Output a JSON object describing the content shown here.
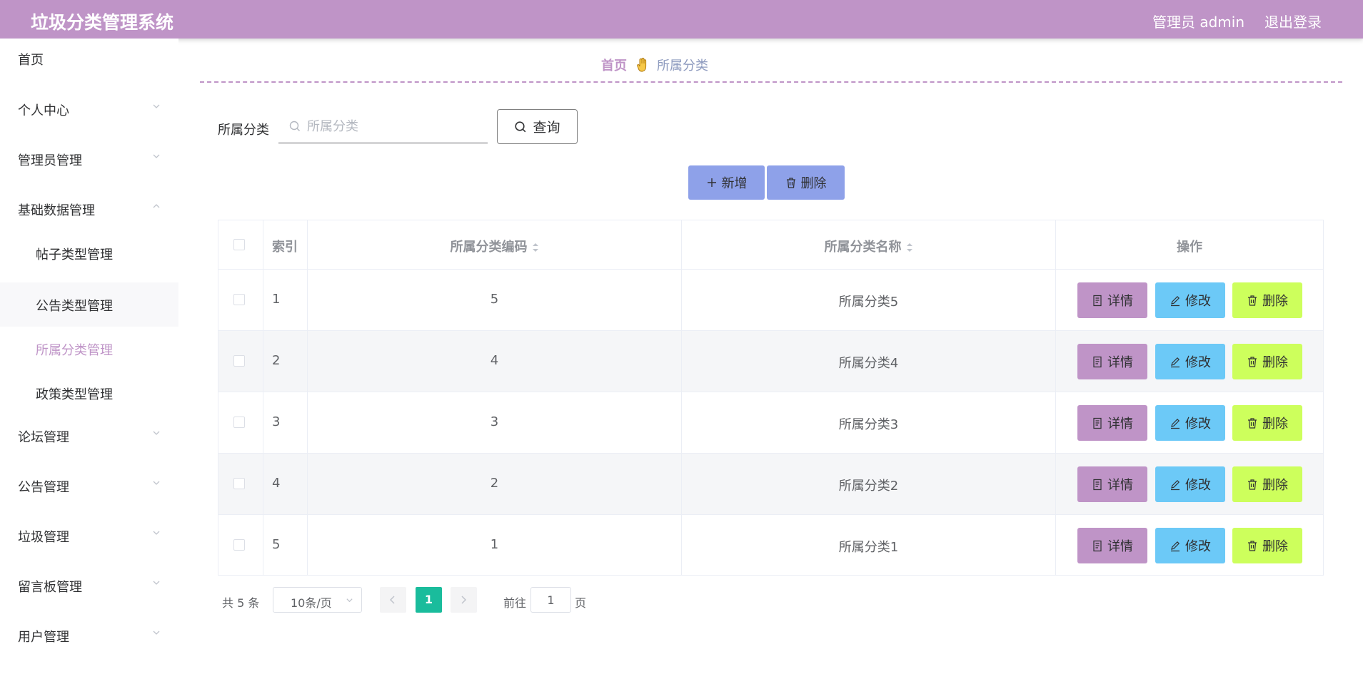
{
  "header": {
    "title": "垃圾分类管理系统",
    "user": "管理员 admin",
    "logout": "退出登录",
    "bg_color": "#bf94c7"
  },
  "sidebar": {
    "items": [
      {
        "label": "首页",
        "has_chevron": false
      },
      {
        "label": "个人中心",
        "has_chevron": true,
        "expanded": false
      },
      {
        "label": "管理员管理",
        "has_chevron": true,
        "expanded": false
      },
      {
        "label": "基础数据管理",
        "has_chevron": true,
        "expanded": true
      },
      {
        "label": "论坛管理",
        "has_chevron": true,
        "expanded": false
      },
      {
        "label": "公告管理",
        "has_chevron": true,
        "expanded": false
      },
      {
        "label": "垃圾管理",
        "has_chevron": true,
        "expanded": false
      },
      {
        "label": "留言板管理",
        "has_chevron": true,
        "expanded": false
      },
      {
        "label": "用户管理",
        "has_chevron": true,
        "expanded": false
      }
    ],
    "subitems": [
      {
        "label": "帖子类型管理"
      },
      {
        "label": "公告类型管理"
      },
      {
        "label": "所属分类管理",
        "active": true
      },
      {
        "label": "政策类型管理"
      }
    ],
    "active_color": "#bf94c7"
  },
  "breadcrumb": {
    "home": "首页",
    "separator_icon": "hand-icon",
    "current": "所属分类"
  },
  "search": {
    "label": "所属分类",
    "value": "",
    "placeholder": "所属分类",
    "button": "查询"
  },
  "toolbar": {
    "add": "新增",
    "delete": "删除",
    "button_color": "#8ea1e9"
  },
  "table": {
    "columns": [
      "索引",
      "所属分类编码",
      "所属分类名称",
      "操作"
    ],
    "rows": [
      {
        "index": "1",
        "code": "5",
        "name": "所属分类5"
      },
      {
        "index": "2",
        "code": "4",
        "name": "所属分类4"
      },
      {
        "index": "3",
        "code": "3",
        "name": "所属分类3"
      },
      {
        "index": "4",
        "code": "2",
        "name": "所属分类2"
      },
      {
        "index": "5",
        "code": "1",
        "name": "所属分类1"
      }
    ],
    "actions": {
      "detail": "详情",
      "edit": "修改",
      "delete": "删除",
      "detail_color": "#bf94c7",
      "edit_color": "#6cc9f7",
      "delete_color": "#cdff5c"
    }
  },
  "pagination": {
    "total": "共 5 条",
    "page_size": "10条/页",
    "current_page": "1",
    "goto_label": "前往",
    "goto_value": "1",
    "goto_suffix": "页",
    "active_color": "#1abc9c"
  }
}
